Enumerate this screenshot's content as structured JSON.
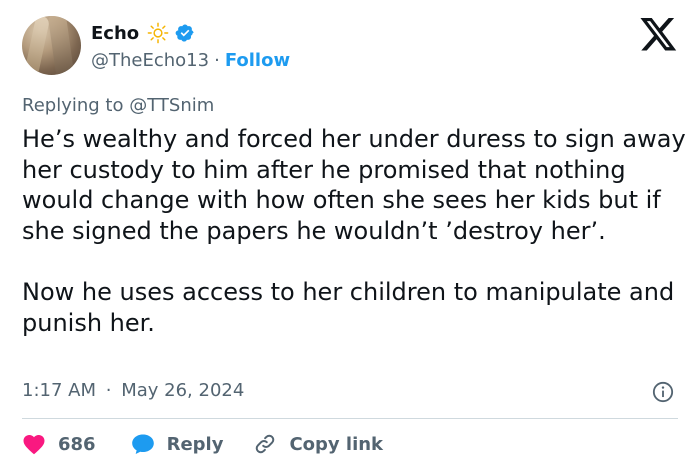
{
  "author": {
    "display_name": "Echo",
    "handle": "@TheEcho13",
    "separator": "·",
    "follow_label": "Follow",
    "emoji_icon": "sun-icon",
    "verified_icon": "verified-badge-icon",
    "accent_color": "#1d9bf0"
  },
  "reply_context": {
    "prefix": "Replying to",
    "mention": "@TTSnim"
  },
  "tweet": {
    "text": "He’s wealthy and forced her under duress to sign away her custody to him after he promised that nothing would change with how often she sees her kids but if she signed the papers he wouldn’t ’destroy her’.\n\nNow he uses access to her children to manipulate and punish her.",
    "time": "1:17 AM",
    "separator": "·",
    "date": "May 26, 2024"
  },
  "actions": {
    "like_count": "686",
    "reply_label": "Reply",
    "copy_link_label": "Copy link",
    "like_color": "#f91880"
  }
}
